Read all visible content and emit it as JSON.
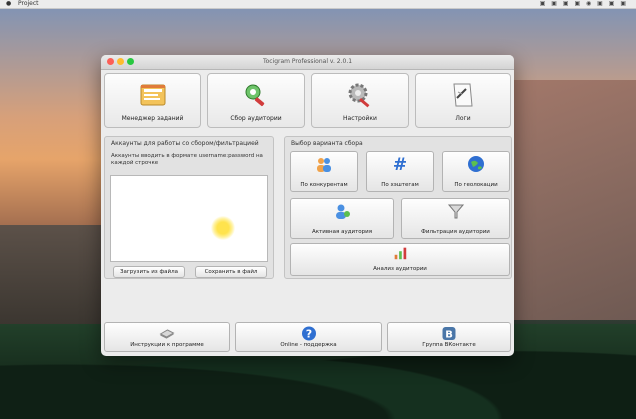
{
  "menubar": {
    "apple": "",
    "app_name": "Project",
    "right_items": "▣ ▣ ▣ ▣ ◉ ▣ ▣ ▣"
  },
  "window": {
    "title": "Tocigram Professional v. 2.0.1"
  },
  "tiles": [
    {
      "label": "Менеджер заданий",
      "icon": "task-manager-icon"
    },
    {
      "label": "Сбор аудитории",
      "icon": "audience-collect-icon"
    },
    {
      "label": "Настройки",
      "icon": "settings-icon"
    },
    {
      "label": "Логи",
      "icon": "logs-icon"
    }
  ],
  "accounts": {
    "title": "Аккаунты для работы со сбором/фильтрацией",
    "hint": "Аккаунты вводить в формате username:password на каждой строчке",
    "load_label": "Загрузить из файла",
    "save_label": "Сохранить в файл"
  },
  "collect": {
    "title": "Выбор варианта сбора",
    "options": [
      {
        "label": "По конкурентам",
        "icon": "competitors-icon"
      },
      {
        "label": "По хэштегам",
        "icon": "hashtag-icon"
      },
      {
        "label": "По геолокации",
        "icon": "globe-icon"
      },
      {
        "label": "Активная аудитория",
        "icon": "active-audience-icon"
      },
      {
        "label": "Фильтрация аудитории",
        "icon": "filter-icon"
      },
      {
        "label": "Анализ аудитории",
        "icon": "analysis-chart-icon"
      }
    ]
  },
  "bottom": [
    {
      "label": "Инструкции к программе",
      "icon": "instructions-icon"
    },
    {
      "label": "Online - поддержка",
      "icon": "help-icon"
    },
    {
      "label": "Группа ВКонтакте",
      "icon": "vk-icon"
    }
  ],
  "colors": {
    "accent_blue": "#2f6fd1",
    "tile_bg": "#f5f5f5",
    "window_bg": "#ececec"
  }
}
